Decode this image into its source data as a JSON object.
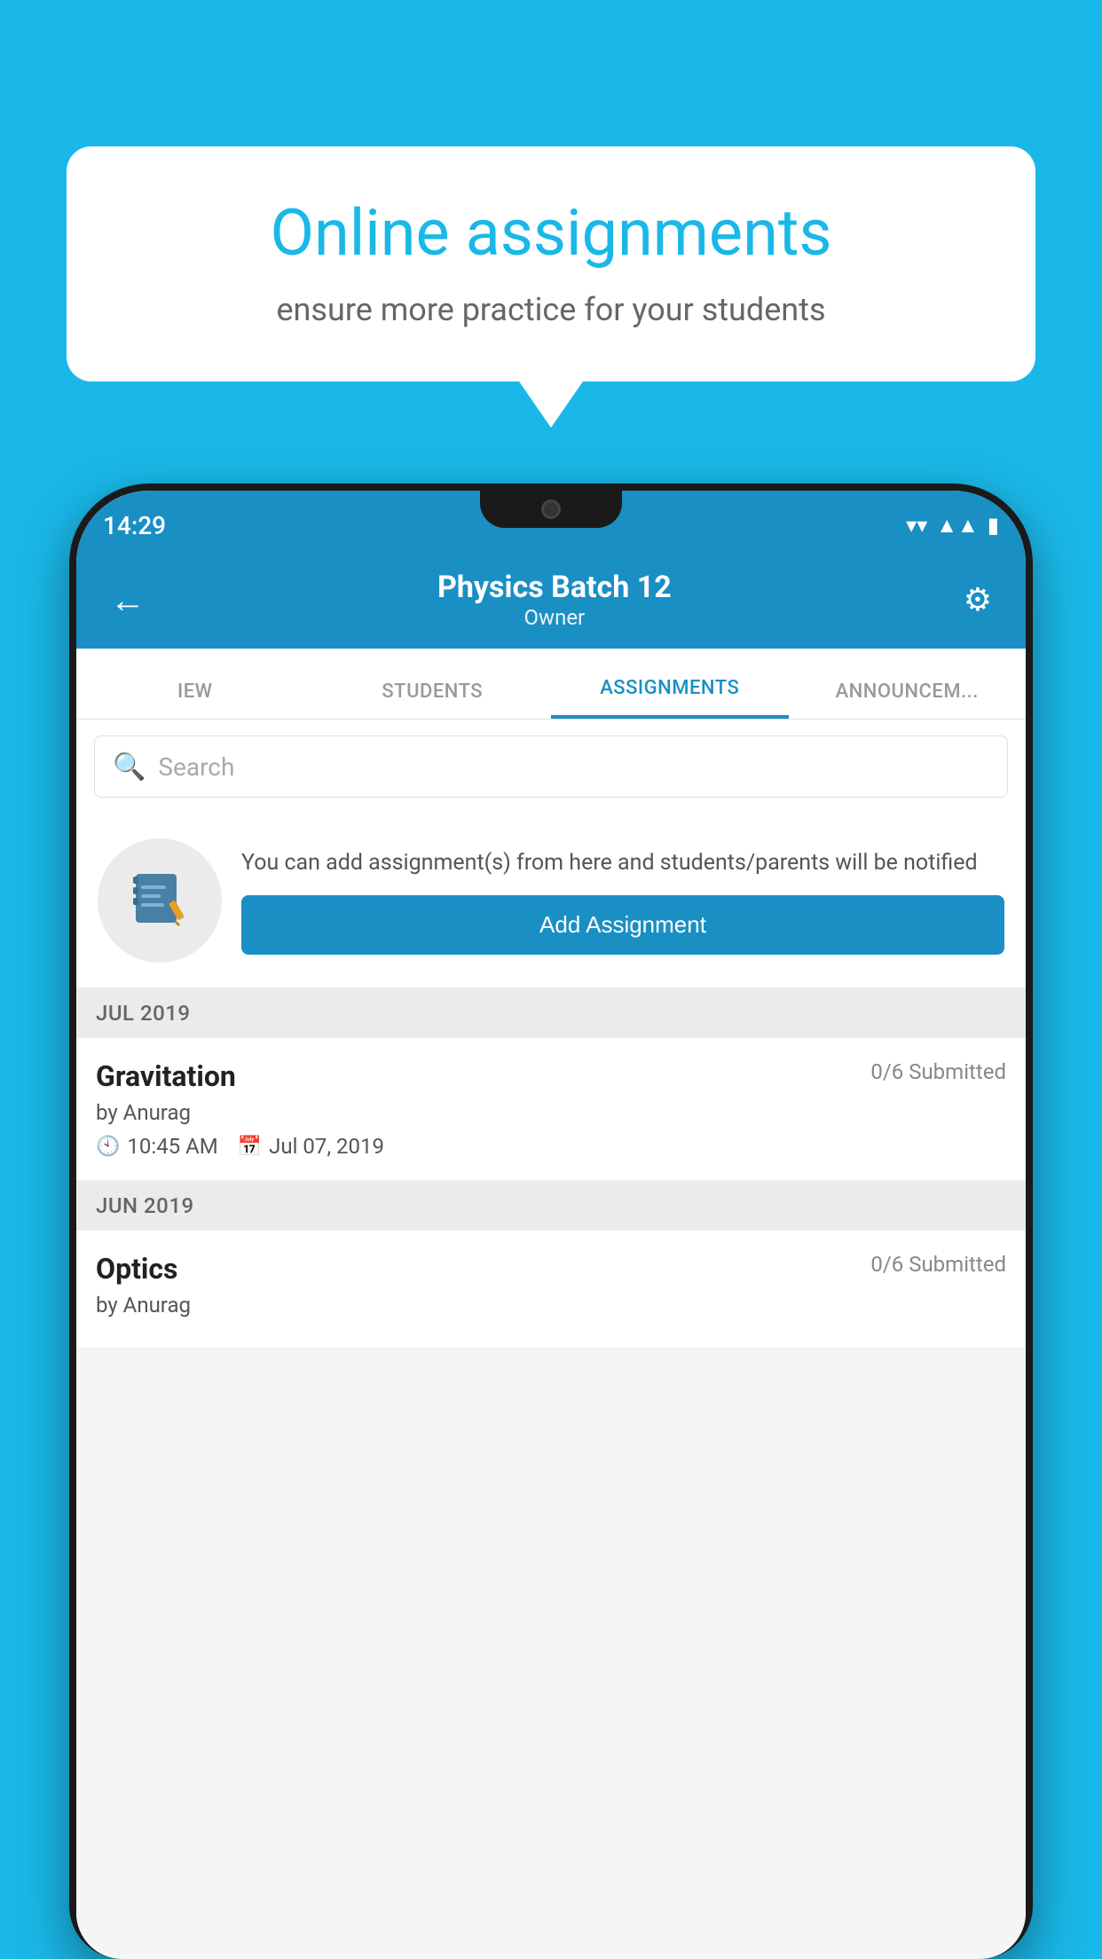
{
  "background_color": "#1ab8e8",
  "speech_bubble": {
    "title": "Online assignments",
    "subtitle": "ensure more practice for your students"
  },
  "status_bar": {
    "time": "14:29",
    "icons": [
      "wifi",
      "signal",
      "battery"
    ]
  },
  "app_bar": {
    "title": "Physics Batch 12",
    "subtitle": "Owner",
    "back_label": "←",
    "settings_label": "⚙"
  },
  "tabs": [
    {
      "label": "IEW",
      "active": false
    },
    {
      "label": "STUDENTS",
      "active": false
    },
    {
      "label": "ASSIGNMENTS",
      "active": true
    },
    {
      "label": "ANNOUNCEM...",
      "active": false
    }
  ],
  "search": {
    "placeholder": "Search"
  },
  "promo": {
    "text": "You can add assignment(s) from here and students/parents will be notified",
    "button_label": "Add Assignment"
  },
  "sections": [
    {
      "label": "JUL 2019",
      "assignments": [
        {
          "name": "Gravitation",
          "submitted": "0/6 Submitted",
          "by": "by Anurag",
          "time": "10:45 AM",
          "date": "Jul 07, 2019"
        }
      ]
    },
    {
      "label": "JUN 2019",
      "assignments": [
        {
          "name": "Optics",
          "submitted": "0/6 Submitted",
          "by": "by Anurag",
          "time": "",
          "date": ""
        }
      ]
    }
  ]
}
